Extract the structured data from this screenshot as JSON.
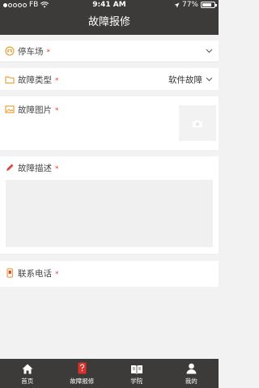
{
  "status": {
    "carrier": "FB",
    "time": "9:41 AM",
    "battery": "77%",
    "battery_level": 0.77
  },
  "nav": {
    "title": "故障报修"
  },
  "form": {
    "parking": {
      "label": "停车场",
      "required": "*"
    },
    "fault_type": {
      "label": "故障类型",
      "required": "*",
      "value": "软件故障"
    },
    "fault_photo": {
      "label": "故障图片",
      "required": "*"
    },
    "fault_desc": {
      "label": "故障描述",
      "required": "*"
    },
    "phone": {
      "label": "联系电话",
      "required": "*"
    }
  },
  "tabbar": {
    "items": [
      {
        "label": "首页",
        "icon": "home-icon"
      },
      {
        "label": "故障报修",
        "icon": "repair-icon"
      },
      {
        "label": "学院",
        "icon": "book-icon"
      },
      {
        "label": "我的",
        "icon": "user-icon"
      }
    ]
  },
  "colors": {
    "bar": "#3d3b39",
    "accent": "#e8a23a",
    "required": "#e0463c",
    "active_tab_icon": "#d9322b"
  }
}
